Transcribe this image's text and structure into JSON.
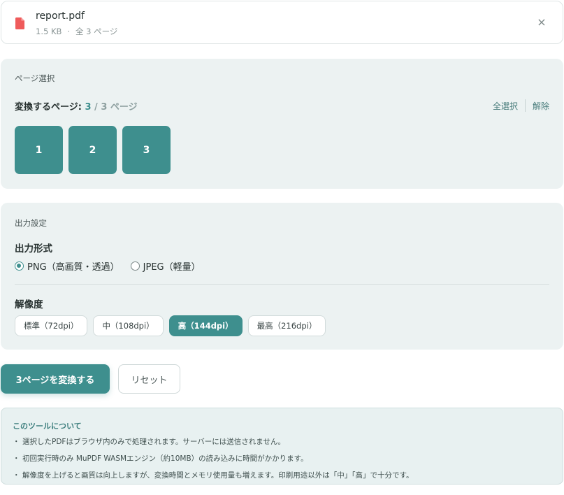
{
  "file": {
    "name": "report.pdf",
    "size": "1.5 KB",
    "separator": "·",
    "pages_text": "全 3 ページ",
    "close_symbol": "×",
    "icon": "pdf-file-icon",
    "icon_color": "#ef5b5b"
  },
  "page_select": {
    "label": "ページ選択",
    "summary_prefix": "変換するページ: ",
    "selected": "3",
    "total_text": " / 3 ページ",
    "select_all": "全選択",
    "clear": "解除",
    "pages": [
      "1",
      "2",
      "3"
    ]
  },
  "output": {
    "label": "出力設定",
    "format_heading": "出力形式",
    "formats": [
      {
        "label": "PNG（高画質・透過）",
        "checked": true
      },
      {
        "label": "JPEG（軽量）",
        "checked": false
      }
    ],
    "resolution_heading": "解像度",
    "resolutions": [
      {
        "label": "標準（72dpi）",
        "active": false
      },
      {
        "label": "中（108dpi）",
        "active": false
      },
      {
        "label": "高（144dpi）",
        "active": true
      },
      {
        "label": "最高（216dpi）",
        "active": false
      }
    ]
  },
  "actions": {
    "convert": "3ページを変換する",
    "reset": "リセット"
  },
  "info": {
    "title": "このツールについて",
    "bullet": "・",
    "items": [
      "選択したPDFはブラウザ内のみで処理されます。サーバーには送信されません。",
      "初回実行時のみ MuPDF WASMエンジン（約10MB）の読み込みに時間がかかります。",
      "解像度を上げると画質は向上しますが、変換時間とメモリ使用量も増えます。印刷用途以外は「中」「高」で十分です。"
    ]
  },
  "colors": {
    "accent": "#3e8f8e",
    "panel": "#ecf2f2",
    "info_bg": "#e8f1f1"
  }
}
